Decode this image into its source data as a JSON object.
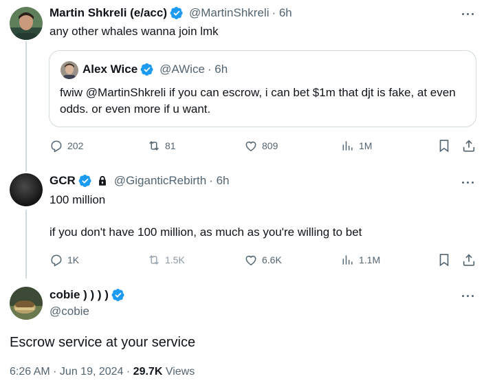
{
  "tweets": [
    {
      "name": "Martin Shkreli (e/acc)",
      "handle": "@MartinShkreli",
      "time": "· 6h",
      "text": "any other whales wanna join lmk",
      "quote": {
        "name": "Alex Wice",
        "handle": "@AWice",
        "time": "· 6h",
        "text": "fwiw @MartinShkreli  if you can escrow, i can bet $1m that djt is fake, at even odds.  or even more if u want."
      },
      "stats": {
        "replies": "202",
        "reposts": "81",
        "likes": "809",
        "views": "1M"
      }
    },
    {
      "name": "GCR",
      "handle": "@GiganticRebirth",
      "time": "· 6h",
      "text_line1": "100 million",
      "text_line2": "if you don't have 100 million, as much as you're willing to bet",
      "stats": {
        "replies": "1K",
        "reposts": "1.5K",
        "likes": "6.6K",
        "views": "1.1M"
      }
    }
  ],
  "main_tweet": {
    "name": "cobie ) ) ) )",
    "handle": "@cobie",
    "text": "Escrow service at your service",
    "date": "6:26 AM · Jun 19, 2024 · ",
    "views_count": "29.7K",
    "views_label": " Views"
  },
  "colors": {
    "verified_blue": "#1d9bf0",
    "text_primary": "#0f1419",
    "text_secondary": "#536471",
    "border": "#cfd9de"
  }
}
